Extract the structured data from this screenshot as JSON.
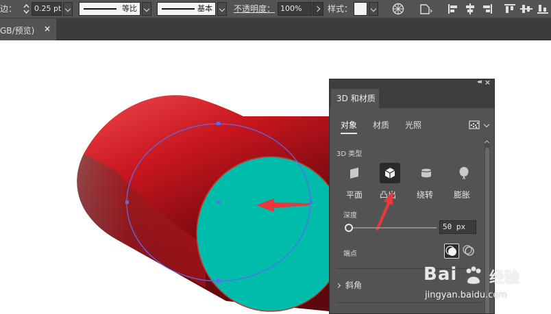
{
  "toolbar": {
    "stroke_label": "边：",
    "stroke_value": "0.25 pt",
    "profile_label": "等比",
    "brush_label": "基本",
    "opacity_label": "不透明度：",
    "opacity_value": "100%",
    "style_label": "样式："
  },
  "document": {
    "tab_title": "GB/预览)",
    "close_glyph": "×"
  },
  "panel": {
    "title": "3D 和材质",
    "tabs": [
      "对象",
      "材质",
      "光照"
    ],
    "section_3d_type": "3D 类型",
    "types": [
      {
        "label": "平面"
      },
      {
        "label": "凸出"
      },
      {
        "label": "绕转"
      },
      {
        "label": "膨胀"
      }
    ],
    "selected_type": "凸出",
    "depth_label": "深度",
    "depth_value": "50 px",
    "cap_label": "端点",
    "bevel_label": "斜角"
  },
  "colors": {
    "cylinder_face": "#00bcaa",
    "cylinder_body": "#c4161c",
    "selection_path": "#5a6cf0",
    "arrow": "#e8383d",
    "panel_bg": "#535353"
  },
  "watermark": {
    "brand": "Bai",
    "brand2": "经验",
    "url": "jingyan.baidu.com"
  }
}
